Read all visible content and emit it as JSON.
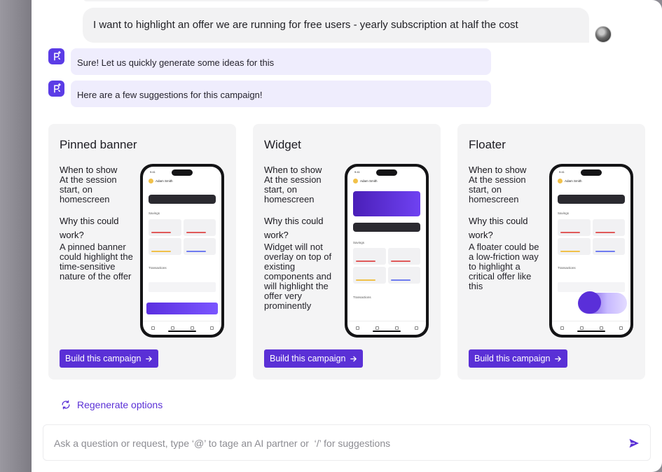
{
  "chat": {
    "user_message": "I want to highlight an offer we are running for free users - yearly subscription at half the cost",
    "bot_messages": [
      "Sure! Let us quickly generate some ideas for this",
      "Here are a few suggestions for this campaign!"
    ]
  },
  "cards": [
    {
      "title": "Pinned banner",
      "when_label": "When to show",
      "when_value": "At the session start, on homescreen",
      "why_label": "Why this could work?",
      "why_value": "A pinned banner could highlight the time-sensitive nature of the offer",
      "button": "Build this campaign"
    },
    {
      "title": "Widget",
      "when_label": "When to show",
      "when_value": "At the session start, on homescreen",
      "why_label": "Why this could work?",
      "why_value": "Widget will not overlay on top of existing components and will highlight the offer very prominently",
      "button": "Build this campaign"
    },
    {
      "title": "Floater",
      "when_label": "When to show",
      "when_value": "At the session start, on homescreen",
      "why_label": "Why this could work?",
      "why_value": "A floater could be a low-friction way to highlight a critical offer like this",
      "button": "Build this campaign"
    }
  ],
  "phone": {
    "time": "9:41",
    "greeting": "Good Morning!",
    "name": "Adam Smith",
    "savings": "Savings",
    "transactions": "Transactions"
  },
  "regenerate_label": "Regenerate options",
  "input": {
    "placeholder": "Ask a question or request, type ‘@’ to tage an AI partner or  ‘/’ for suggestions"
  },
  "colors": {
    "accent": "#5a30d6",
    "bot_bubble": "#efedfd",
    "user_bubble": "#f2f2f3",
    "card_bg": "#f4f4f5"
  },
  "icons": [
    "bot-sparkle-icon",
    "arrow-right-icon",
    "refresh-icon",
    "send-icon"
  ]
}
